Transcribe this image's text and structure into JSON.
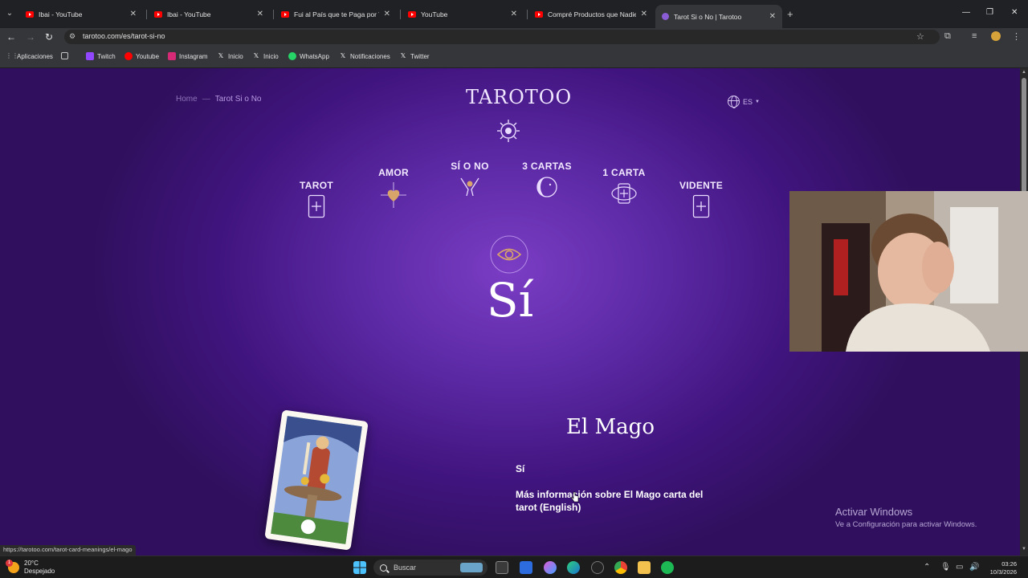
{
  "browser": {
    "tabs": [
      {
        "title": "Ibai - YouTube",
        "favicon": "youtube-icon"
      },
      {
        "title": "Ibai - YouTube",
        "favicon": "youtube-icon"
      },
      {
        "title": "Fui al País que te Paga por Visi",
        "favicon": "youtube-icon"
      },
      {
        "title": "YouTube",
        "favicon": "youtube-icon"
      },
      {
        "title": "Compré Productos que Nadie C",
        "favicon": "youtube-icon"
      },
      {
        "title": "Tarot Si o No | Tarotoo",
        "favicon": "tarotoo-icon",
        "active": true
      }
    ],
    "url": "tarotoo.com/es/tarot-si-no",
    "bookmarks": [
      "Aplicaciones",
      "Twitch",
      "Youtube",
      "Instagram",
      "Inicio",
      "Inicio",
      "WhatsApp",
      "Notificaciones",
      "Twitter"
    ],
    "status_url": "https://tarotoo.com/tarot-card-meanings/el-mago"
  },
  "page": {
    "breadcrumb": {
      "home": "Home",
      "separator": "—",
      "current": "Tarot Si o No"
    },
    "logo": "TAROTOO",
    "language": "ES",
    "menu": [
      {
        "label": "TAROT",
        "icon": "tarot-card-icon"
      },
      {
        "label": "AMOR",
        "icon": "heart-icon"
      },
      {
        "label": "SÍ O NO",
        "icon": "hands-icon"
      },
      {
        "label": "3 CARTAS",
        "icon": "moon-face-icon"
      },
      {
        "label": "1 CARTA",
        "icon": "eye-card-icon"
      },
      {
        "label": "VIDENTE",
        "icon": "tarot-card-icon"
      }
    ],
    "answer": "Sí",
    "card_name": "El Mago",
    "card_answer": "Sí",
    "card_link": "Más información sobre El Mago carta del tarot (English)"
  },
  "watermark": {
    "title": "Activar Windows",
    "subtitle": "Ve a Configuración para activar Windows."
  },
  "taskbar": {
    "weather_temp": "20°C",
    "weather_desc": "Despejado",
    "weather_badge": "1",
    "search_placeholder": "Buscar",
    "time": "03:26",
    "date": "10/3/2026"
  },
  "colors": {
    "accent": "#7a3dc4",
    "page_bg": "#40147e",
    "chrome": "#35363a"
  }
}
